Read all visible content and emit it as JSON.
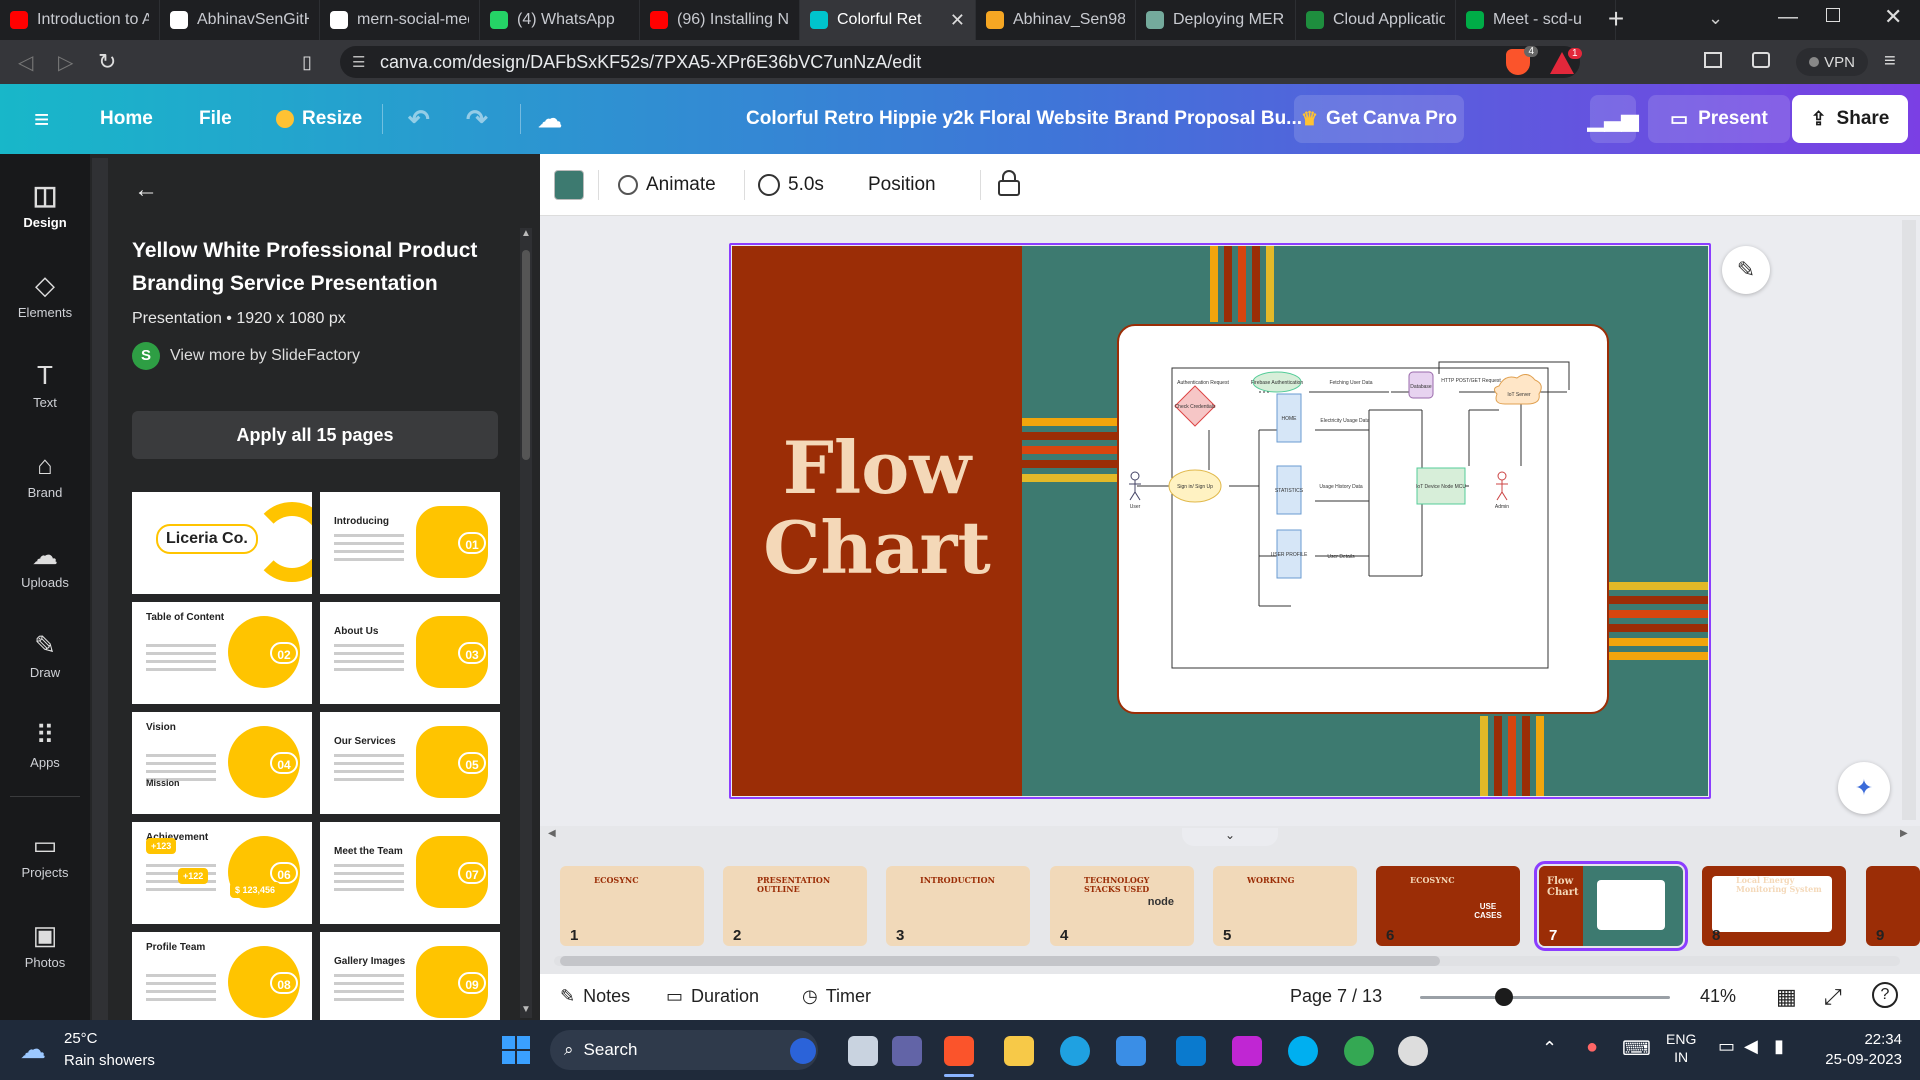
{
  "browser": {
    "tabs": [
      {
        "title": "Introduction to A",
        "icon": "youtube-icon",
        "color": "#ff0000"
      },
      {
        "title": "AbhinavSenGitHu",
        "icon": "github-icon",
        "color": "#ffffff"
      },
      {
        "title": "mern-social-med",
        "icon": "github-icon",
        "color": "#ffffff"
      },
      {
        "title": "(4) WhatsApp",
        "icon": "whatsapp-icon",
        "color": "#25d366"
      },
      {
        "title": "(96) Installing No",
        "icon": "youtube-icon",
        "color": "#ff0000"
      },
      {
        "title": "Colorful Ret",
        "icon": "canva-icon",
        "color": "#00c4cc"
      },
      {
        "title": "Abhinav_Sen987",
        "icon": "tab-icon",
        "color": "#f5a623"
      },
      {
        "title": "Deploying MERN",
        "icon": "chatgpt-icon",
        "color": "#74aa9c"
      },
      {
        "title": "Cloud Applicatio",
        "icon": "classroom-icon",
        "color": "#1e8e3e"
      },
      {
        "title": "Meet - scd-u",
        "icon": "meet-icon",
        "color": "#00ac47"
      }
    ],
    "url": "canva.com/design/DAFbSxKF52s/7PXA5-XPr6E36bVC7unNzA/edit",
    "vpn_label": "VPN",
    "shield_badge": "4",
    "alert_badge": "1"
  },
  "canva_header": {
    "home": "Home",
    "file": "File",
    "resize": "Resize",
    "doc_title": "Colorful Retro Hippie y2k Floral Website Brand Proposal Bu...",
    "get_pro": "Get Canva Pro",
    "present": "Present",
    "share": "Share"
  },
  "rail": [
    {
      "label": "Design",
      "icon": "design-icon"
    },
    {
      "label": "Elements",
      "icon": "elements-icon"
    },
    {
      "label": "Text",
      "icon": "text-icon"
    },
    {
      "label": "Brand",
      "icon": "brand-icon"
    },
    {
      "label": "Uploads",
      "icon": "uploads-icon"
    },
    {
      "label": "Draw",
      "icon": "draw-icon"
    },
    {
      "label": "Apps",
      "icon": "apps-icon"
    },
    {
      "label": "Projects",
      "icon": "projects-icon"
    },
    {
      "label": "Photos",
      "icon": "photos-icon"
    }
  ],
  "template_panel": {
    "title": "Yellow White Professional Product Branding Service Presentation",
    "meta": "Presentation • 1920 x 1080 px",
    "author": "View more by SlideFactory",
    "author_initial": "S",
    "apply": "Apply all 15 pages",
    "thumbs": [
      {
        "title": "Liceria Co.",
        "num": ""
      },
      {
        "title": "Introducing",
        "num": "01"
      },
      {
        "title": "Table of Content",
        "num": "02"
      },
      {
        "title": "About Us",
        "num": "03"
      },
      {
        "title": "Vision",
        "num": "04"
      },
      {
        "title": "Our Services",
        "num": "05"
      },
      {
        "title": "Achievement",
        "num": "06"
      },
      {
        "title": "Meet the Team",
        "num": "07"
      },
      {
        "title": "Profile Team",
        "num": "08"
      },
      {
        "title": "Gallery Images",
        "num": "09"
      }
    ],
    "thumb_extra": {
      "mission": "Mission",
      "stat_a": "+123",
      "stat_b": "+122",
      "stat_c": "$ 123,456"
    }
  },
  "context_toolbar": {
    "color_swatch": "#3d7a70",
    "animate": "Animate",
    "duration": "5.0s",
    "position": "Position"
  },
  "slide": {
    "title_line1": "Flow",
    "title_line2": "Chart",
    "flowchart": {
      "nodes": {
        "auth": "Authentication Request",
        "firebase": "Firebase Authentication",
        "fetch": "Fetching User Data",
        "database": "Database",
        "http": "HTTP POST/GET Request",
        "iot_server": "IoT Server",
        "check": "Check Credentials",
        "home": "HOME",
        "elec": "Electricity Usage Data",
        "signin": "Sign in/ Sign Up",
        "stats": "STATISTICS",
        "usage": "Usage History Data",
        "iot_device": "IoT Device Node MCU",
        "profile": "USER PROFILE",
        "user_details": "User Details",
        "user": "User",
        "admin": "Admin"
      }
    }
  },
  "pages": [
    {
      "num": "1",
      "label": "ECOSYNC",
      "bg": "#f1d9b9"
    },
    {
      "num": "2",
      "label": "PRESENTATION OUTLINE",
      "bg": "#f1d9b9"
    },
    {
      "num": "3",
      "label": "INTRODUCTION",
      "bg": "#f1d9b9"
    },
    {
      "num": "4",
      "label": "TECHNOLOGY STACKS USED",
      "bg": "#f1d9b9"
    },
    {
      "num": "5",
      "label": "WORKING",
      "bg": "#f1d9b9"
    },
    {
      "num": "6",
      "label": "ECOSYNC",
      "bg": "#9b2d06"
    },
    {
      "num": "7",
      "label": "Flow Chart",
      "bg": "#3d7a70"
    },
    {
      "num": "8",
      "label": "Local Energy Monitoring System",
      "bg": "#9b2d06"
    },
    {
      "num": "9",
      "label": "",
      "bg": "#9b2d06"
    }
  ],
  "pages_extra": {
    "tech_node": "node",
    "usecase": "USE CASES"
  },
  "bottom_bar": {
    "notes": "Notes",
    "duration": "Duration",
    "timer": "Timer",
    "page_indicator": "Page 7 / 13",
    "zoom": "41%",
    "zoom_fraction": 0.41
  },
  "taskbar": {
    "weather_temp": "25°C",
    "weather_desc": "Rain showers",
    "search": "Search",
    "lang1": "ENG",
    "lang2": "IN",
    "time": "22:34",
    "date": "25-09-2023"
  }
}
